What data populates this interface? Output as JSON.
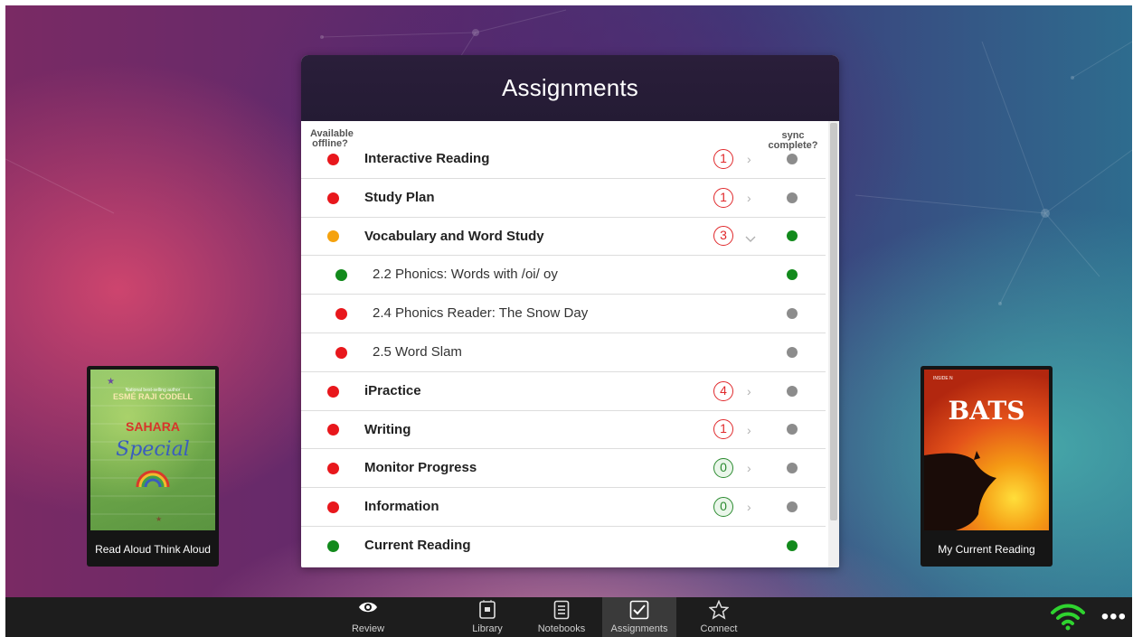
{
  "panel": {
    "title": "Assignments",
    "col_offline": "Available offline?",
    "col_sync": "sync complete?"
  },
  "rows": [
    {
      "label": "Interactive Reading",
      "offline": "red",
      "badge": "1",
      "badge_kind": "alert",
      "chevron": "right",
      "sync": "gray",
      "sub": false
    },
    {
      "label": "Study Plan",
      "offline": "red",
      "badge": "1",
      "badge_kind": "alert",
      "chevron": "right",
      "sync": "gray",
      "sub": false
    },
    {
      "label": "Vocabulary and Word Study",
      "offline": "orange",
      "badge": "3",
      "badge_kind": "alert",
      "chevron": "down",
      "sync": "green",
      "sub": false
    },
    {
      "label": "2.2 Phonics: Words with /oi/ oy",
      "offline": "green",
      "badge": "",
      "chevron": "",
      "sync": "green",
      "sub": true
    },
    {
      "label": "2.4 Phonics Reader: The Snow Day",
      "offline": "red",
      "badge": "",
      "chevron": "",
      "sync": "gray",
      "sub": true
    },
    {
      "label": "2.5 Word Slam",
      "offline": "red",
      "badge": "",
      "chevron": "",
      "sync": "gray",
      "sub": true
    },
    {
      "label": "iPractice",
      "offline": "red",
      "badge": "4",
      "badge_kind": "alert",
      "chevron": "right",
      "sync": "gray",
      "sub": false
    },
    {
      "label": "Writing",
      "offline": "red",
      "badge": "1",
      "badge_kind": "alert",
      "chevron": "right",
      "sync": "gray",
      "sub": false
    },
    {
      "label": "Monitor Progress",
      "offline": "red",
      "badge": "0",
      "badge_kind": "zero",
      "chevron": "right",
      "sync": "gray",
      "sub": false
    },
    {
      "label": "Information",
      "offline": "red",
      "badge": "0",
      "badge_kind": "zero",
      "chevron": "right",
      "sync": "gray",
      "sub": false
    },
    {
      "label": "Current Reading",
      "offline": "green",
      "badge": "",
      "chevron": "",
      "sync": "green",
      "sub": false
    }
  ],
  "books": {
    "left": {
      "caption": "Read Aloud Think Aloud",
      "cover_author": "ESMÉ RAJI CODELL",
      "cover_tagline": "National best-selling author",
      "cover_title_line1": "SAHARA",
      "cover_title_line2": "Special"
    },
    "right": {
      "caption": "My Current Reading",
      "cover_series": "INSIDE N",
      "cover_title": "BATS"
    }
  },
  "nav": {
    "review": "Review",
    "library": "Library",
    "notebooks": "Notebooks",
    "assignments": "Assignments",
    "connect": "Connect",
    "active": "assignments",
    "more": "•••"
  },
  "colors": {
    "red": "#e8171c",
    "orange": "#f5a20e",
    "green": "#128a1c",
    "gray": "#8c8c8c",
    "wifi": "#2fd32f"
  }
}
